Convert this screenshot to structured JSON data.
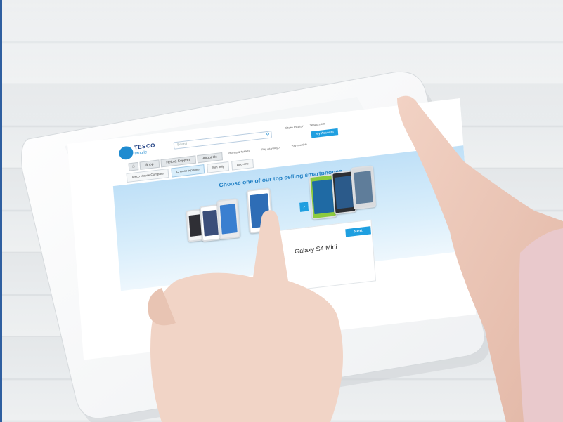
{
  "screen": {
    "brand": {
      "name": "TESCO",
      "sub": "mobile"
    },
    "search": {
      "placeholder": "Search",
      "icon": "search-icon"
    },
    "top_links": [
      "Store locator",
      "Tesco.com"
    ],
    "account_button": "My Account",
    "nav_tabs": [
      "Shop",
      "Help & Support",
      "About Us"
    ],
    "nav_extra": [
      "Phones & Tablets",
      "Pay as you go",
      "Pay monthly"
    ],
    "subnav": [
      "Tesco Mobile Compare",
      "Choose a phone",
      "Sim only",
      "Add-ons"
    ],
    "hero_title": "Choose one of our top selling smartphones",
    "phone_colors": [
      "#2f2f35",
      "#e9eaec",
      "#3a3f46",
      "#dfe2e6",
      "#8ccb3e",
      "#2d2f33"
    ],
    "panel_button": "Next",
    "model_name": "Galaxy S4 Mini",
    "accent": "#1f9fe0"
  }
}
